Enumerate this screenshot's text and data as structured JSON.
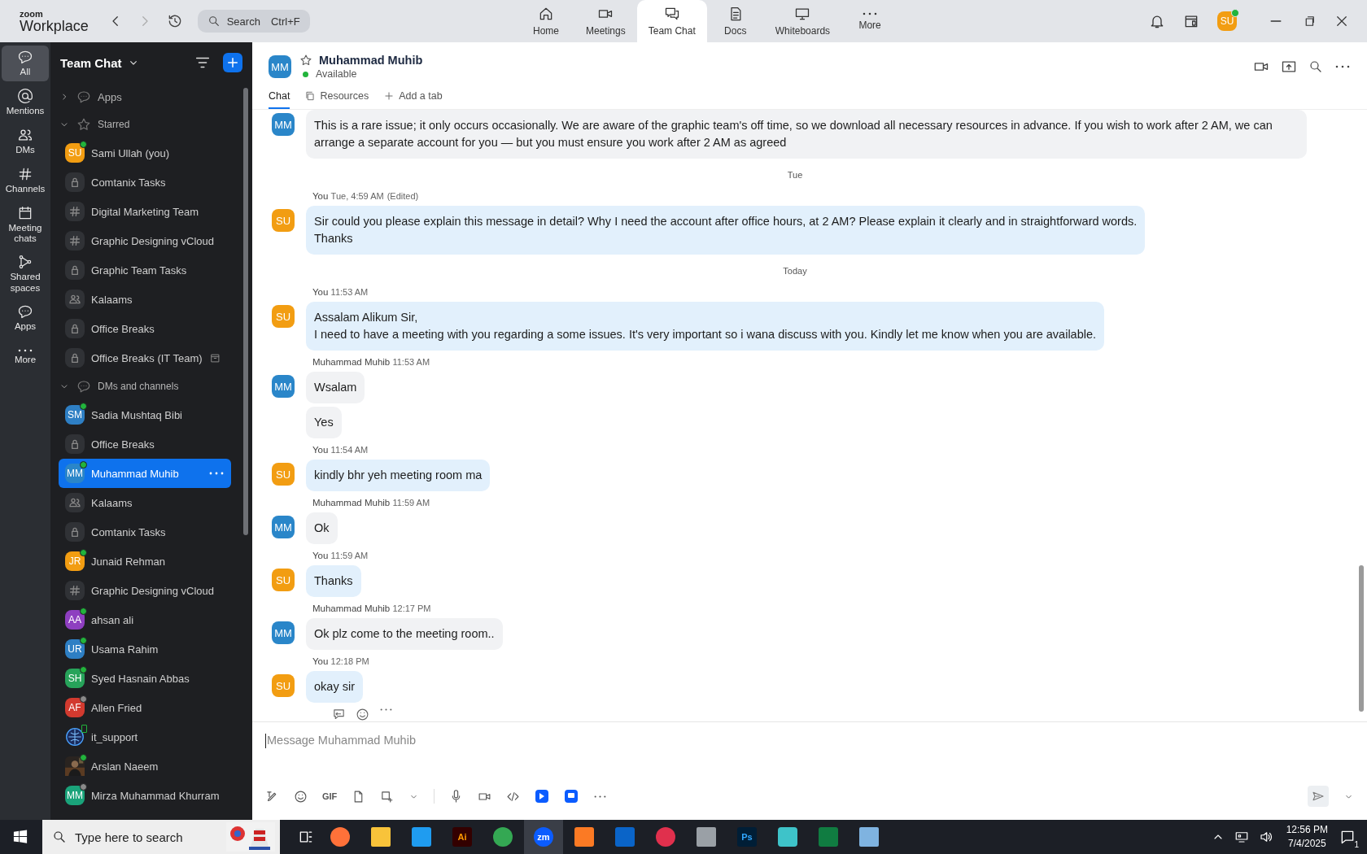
{
  "app": {
    "logo_top": "zoom",
    "logo_bottom": "Workplace"
  },
  "search": {
    "placeholder": "Search",
    "shortcut": "Ctrl+F"
  },
  "nav_tabs": [
    {
      "label": "Home",
      "kind": "home",
      "selected": false
    },
    {
      "label": "Meetings",
      "kind": "video",
      "selected": false
    },
    {
      "label": "Team Chat",
      "kind": "chat",
      "selected": true
    },
    {
      "label": "Docs",
      "kind": "doc",
      "selected": false
    },
    {
      "label": "Whiteboards",
      "kind": "board",
      "selected": false
    },
    {
      "label": "More",
      "kind": "dots",
      "selected": false
    }
  ],
  "user": {
    "initials": "SU",
    "color": "#f29d12",
    "online": true
  },
  "rail": [
    {
      "label": "All",
      "kind": "chat",
      "selected": true
    },
    {
      "label": "Mentions",
      "kind": "at",
      "selected": false
    },
    {
      "label": "DMs",
      "kind": "people",
      "selected": false
    },
    {
      "label": "Channels",
      "kind": "hash",
      "selected": false
    },
    {
      "label": "Meeting chats",
      "kind": "calendar",
      "selected": false
    },
    {
      "label": "Shared spaces",
      "kind": "branch",
      "selected": false
    },
    {
      "label": "Apps",
      "kind": "bubble",
      "selected": false
    },
    {
      "label": "More",
      "kind": "dots",
      "selected": false
    }
  ],
  "sidebar": {
    "title": "Team Chat",
    "sections": [
      {
        "label": "Apps",
        "kind": "apps",
        "expanded": false
      },
      {
        "label": "Starred",
        "kind": "starred",
        "expanded": true,
        "items": [
          {
            "name": "Sami Ullah (you)",
            "kind": "avatar",
            "initials": "SU",
            "color": "#f29d12",
            "online": true,
            "away": false,
            "archived": false,
            "selected": false
          },
          {
            "name": "Comtanix Tasks",
            "kind": "lock",
            "online": false,
            "away": false,
            "archived": false,
            "selected": false
          },
          {
            "name": "Digital Marketing Team",
            "kind": "hash",
            "online": false,
            "away": false,
            "archived": false,
            "selected": false
          },
          {
            "name": "Graphic Designing vCloud",
            "kind": "hash",
            "online": false,
            "away": false,
            "archived": false,
            "selected": false
          },
          {
            "name": "Graphic Team Tasks",
            "kind": "lock",
            "online": false,
            "away": false,
            "archived": false,
            "selected": false
          },
          {
            "name": "Kalaams",
            "kind": "group",
            "online": false,
            "away": false,
            "archived": false,
            "selected": false
          },
          {
            "name": "Office Breaks",
            "kind": "lock",
            "online": false,
            "away": false,
            "archived": false,
            "selected": false
          },
          {
            "name": "Office Breaks (IT Team)",
            "kind": "lock",
            "online": false,
            "away": false,
            "archived": true,
            "selected": false
          }
        ]
      },
      {
        "label": "DMs and channels",
        "kind": "dms",
        "expanded": true,
        "items": [
          {
            "name": "Sadia Mushtaq Bibi",
            "kind": "avatar",
            "initials": "SM",
            "color": "#2e7fc4",
            "online": true,
            "away": false,
            "mobile": false,
            "selected": false
          },
          {
            "name": "Office Breaks",
            "kind": "lock",
            "online": false,
            "away": false,
            "mobile": false,
            "selected": false
          },
          {
            "name": "Muhammad Muhib",
            "kind": "avatar",
            "initials": "MM",
            "color": "#2a86c9",
            "online": true,
            "away": false,
            "mobile": false,
            "selected": true
          },
          {
            "name": "Kalaams",
            "kind": "group",
            "online": false,
            "away": false,
            "mobile": false,
            "selected": false
          },
          {
            "name": "Comtanix Tasks",
            "kind": "lock",
            "online": false,
            "away": false,
            "mobile": false,
            "selected": false
          },
          {
            "name": "Junaid Rehman",
            "kind": "avatar",
            "initials": "JR",
            "color": "#f29d12",
            "online": true,
            "away": false,
            "mobile": false,
            "selected": false
          },
          {
            "name": "Graphic Designing vCloud",
            "kind": "hash",
            "online": false,
            "away": false,
            "mobile": false,
            "selected": false
          },
          {
            "name": "ahsan ali",
            "kind": "avatar",
            "initials": "AA",
            "color": "#8e3fc0",
            "online": true,
            "away": false,
            "mobile": false,
            "selected": false
          },
          {
            "name": "Usama Rahim",
            "kind": "avatar",
            "initials": "UR",
            "color": "#2e7fc4",
            "online": true,
            "away": false,
            "mobile": false,
            "selected": false
          },
          {
            "name": "Syed Hasnain Abbas",
            "kind": "avatar",
            "initials": "SH",
            "color": "#27a35a",
            "online": true,
            "away": false,
            "mobile": false,
            "selected": false
          },
          {
            "name": "Allen Fried",
            "kind": "avatar",
            "initials": "AF",
            "color": "#d23a2f",
            "online": false,
            "away": true,
            "mobile": false,
            "selected": false
          },
          {
            "name": "it_support",
            "kind": "logo",
            "online": false,
            "away": false,
            "mobile": true,
            "selected": false
          },
          {
            "name": "Arslan Naeem",
            "kind": "picture",
            "online": true,
            "away": false,
            "mobile": false,
            "selected": false
          },
          {
            "name": "Mirza Muhammad Khurram",
            "kind": "avatar",
            "initials": "MM",
            "color": "#1aa37a",
            "online": false,
            "away": true,
            "mobile": false,
            "selected": false
          }
        ]
      }
    ]
  },
  "chat": {
    "contact": {
      "initials": "MM",
      "color": "#2a86c9",
      "name": "Muhammad Muhib",
      "status": "Available",
      "starred": false
    },
    "tabs": [
      {
        "label": "Chat",
        "kind": "chat",
        "selected": true
      },
      {
        "label": "Resources",
        "kind": "resources",
        "selected": false
      },
      {
        "label": "Add a tab",
        "kind": "add",
        "selected": false
      }
    ],
    "messages": [
      {
        "kind": "message",
        "mine": false,
        "initials": "MM",
        "color": "#2a86c9",
        "bubbles": [
          "This is a rare issue; it only occurs occasionally. We are aware of the graphic team's off time, so we download all necessary resources in advance. If you wish to work after 2 AM, we can arrange a separate account for you — but you must ensure you work after 2 AM as agreed"
        ]
      },
      {
        "kind": "divider",
        "label": "Tue"
      },
      {
        "kind": "message",
        "mine": true,
        "initials": "SU",
        "color": "#f29d12",
        "sender": "You",
        "time": "Tue, 4:59 AM",
        "note": "(Edited)",
        "bubbles": [
          "Sir could you please explain this message in detail? Why I need the account after office hours, at 2 AM? Please explain it clearly and in straightforward words.\nThanks"
        ]
      },
      {
        "kind": "divider",
        "label": "Today"
      },
      {
        "kind": "message",
        "mine": true,
        "initials": "SU",
        "color": "#f29d12",
        "sender": "You",
        "time": "11:53 AM",
        "bubbles": [
          "Assalam Alikum Sir,\nI need to have a meeting with you regarding a some issues. It's very important so i wana discuss with you. Kindly let me know when you are available."
        ]
      },
      {
        "kind": "message",
        "mine": false,
        "initials": "MM",
        "color": "#2a86c9",
        "sender": "Muhammad Muhib",
        "time": "11:53 AM",
        "bubbles": [
          "Wsalam",
          "Yes"
        ]
      },
      {
        "kind": "message",
        "mine": true,
        "initials": "SU",
        "color": "#f29d12",
        "sender": "You",
        "time": "11:54 AM",
        "bubbles": [
          "kindly bhr yeh meeting room ma"
        ]
      },
      {
        "kind": "message",
        "mine": false,
        "initials": "MM",
        "color": "#2a86c9",
        "sender": "Muhammad Muhib",
        "time": "11:59 AM",
        "bubbles": [
          "Ok"
        ]
      },
      {
        "kind": "message",
        "mine": true,
        "initials": "SU",
        "color": "#f29d12",
        "sender": "You",
        "time": "11:59 AM",
        "bubbles": [
          "Thanks"
        ]
      },
      {
        "kind": "message",
        "mine": false,
        "initials": "MM",
        "color": "#2a86c9",
        "sender": "Muhammad Muhib",
        "time": "12:17 PM",
        "bubbles": [
          "Ok plz come to the meeting room.."
        ]
      },
      {
        "kind": "message",
        "mine": true,
        "initials": "SU",
        "color": "#f29d12",
        "sender": "You",
        "time": "12:18 PM",
        "bubbles": [
          "okay sir"
        ]
      }
    ],
    "composer": {
      "placeholder": "Message Muhammad Muhib",
      "gif": "GIF"
    }
  },
  "taskbar": {
    "search_placeholder": "Type here to search",
    "apps": [
      {
        "kind": "firefox",
        "selected": false
      },
      {
        "kind": "folder",
        "selected": false
      },
      {
        "kind": "vscode",
        "selected": false
      },
      {
        "kind": "illustrator",
        "label": "Ai",
        "selected": false
      },
      {
        "kind": "chrome",
        "selected": false
      },
      {
        "kind": "zoom",
        "label": "zm",
        "selected": true
      },
      {
        "kind": "xampp",
        "selected": false
      },
      {
        "kind": "outlook",
        "selected": false
      },
      {
        "kind": "creative",
        "selected": false
      },
      {
        "kind": "tool",
        "selected": false
      },
      {
        "kind": "photoshop",
        "label": "Ps",
        "selected": false
      },
      {
        "kind": "gem",
        "selected": false
      },
      {
        "kind": "excel",
        "selected": false
      },
      {
        "kind": "notepad",
        "selected": false
      }
    ],
    "time": "12:56 PM",
    "date": "7/4/2025",
    "notifications": "1"
  }
}
